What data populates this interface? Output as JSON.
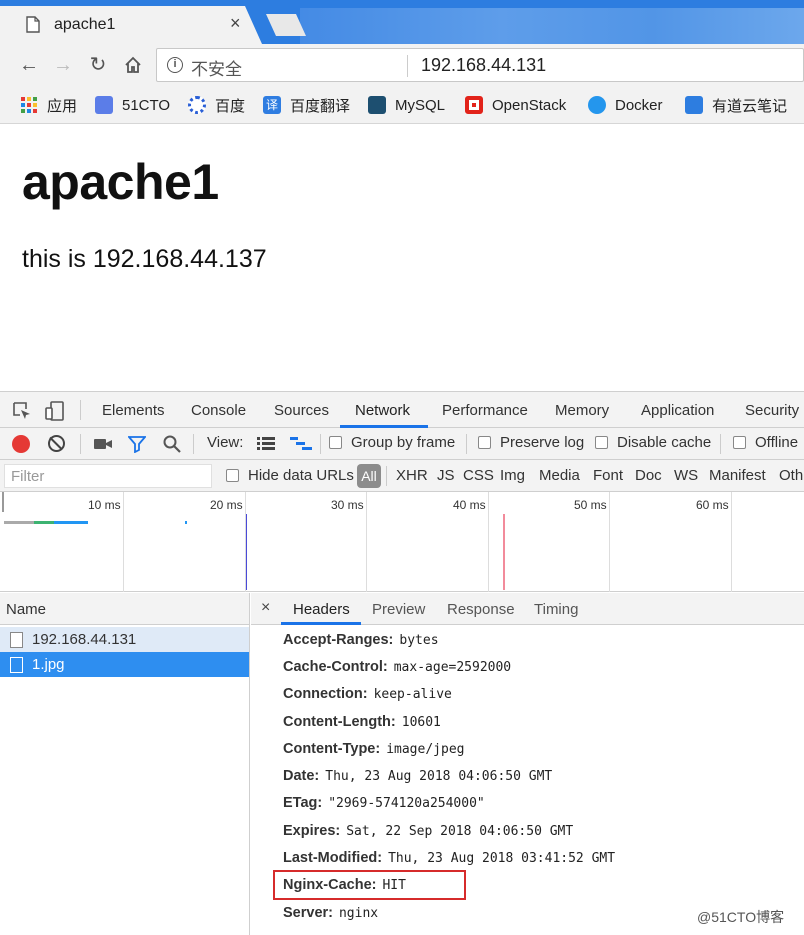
{
  "browser": {
    "tab_title": "apache1",
    "tab_close": "×",
    "security_label": "不安全",
    "url": "192.168.44.131",
    "bookmarks": [
      "应用",
      "51CTO",
      "百度",
      "百度翻译",
      "MySQL",
      "OpenStack",
      "Docker",
      "有道云笔记"
    ]
  },
  "page": {
    "heading": "apache1",
    "text": "this is 192.168.44.137"
  },
  "devtools": {
    "tabs": [
      "Elements",
      "Console",
      "Sources",
      "Network",
      "Performance",
      "Memory",
      "Application",
      "Security"
    ],
    "active_tab": "Network",
    "controls": {
      "view_label": "View:",
      "group_by_frame": "Group by frame",
      "preserve_log": "Preserve log",
      "disable_cache": "Disable cache",
      "offline": "Offline"
    },
    "filter": {
      "placeholder": "Filter",
      "hide_data_urls": "Hide data URLs",
      "types": [
        "All",
        "XHR",
        "JS",
        "CSS",
        "Img",
        "Media",
        "Font",
        "Doc",
        "WS",
        "Manifest",
        "Oth"
      ]
    },
    "timeline_labels": [
      "10 ms",
      "20 ms",
      "30 ms",
      "40 ms",
      "50 ms",
      "60 ms"
    ],
    "name_header": "Name",
    "requests": [
      "192.168.44.131",
      "1.jpg"
    ],
    "selected_request": "1.jpg",
    "detail_close": "×",
    "detail_tabs": [
      "Headers",
      "Preview",
      "Response",
      "Timing"
    ],
    "active_detail_tab": "Headers",
    "headers": [
      {
        "key": "Accept-Ranges:",
        "value": "bytes"
      },
      {
        "key": "Cache-Control:",
        "value": "max-age=2592000"
      },
      {
        "key": "Connection:",
        "value": "keep-alive"
      },
      {
        "key": "Content-Length:",
        "value": "10601"
      },
      {
        "key": "Content-Type:",
        "value": "image/jpeg"
      },
      {
        "key": "Date:",
        "value": "Thu, 23 Aug 2018 04:06:50 GMT"
      },
      {
        "key": "ETag:",
        "value": "\"2969-574120a254000\""
      },
      {
        "key": "Expires:",
        "value": "Sat, 22 Sep 2018 04:06:50 GMT"
      },
      {
        "key": "Last-Modified:",
        "value": "Thu, 23 Aug 2018 03:41:52 GMT"
      },
      {
        "key": "Nginx-Cache:",
        "value": "HIT"
      },
      {
        "key": "Server:",
        "value": "nginx"
      }
    ]
  },
  "watermark": "@51CTO博客",
  "colors": {
    "accent": "#1a73e8",
    "selected_row": "#2e8ef0",
    "highlight_box": "#d62b2b",
    "record": "#e53935"
  }
}
